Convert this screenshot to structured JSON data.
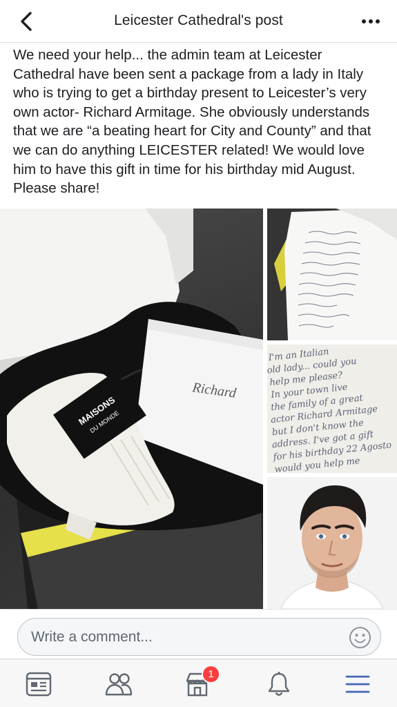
{
  "header": {
    "title": "Leicester Cathedral's post",
    "back_icon": "chevron-left-icon",
    "more_icon": "more-horizontal-icon"
  },
  "post": {
    "text": "We need your help... the admin team at Leicester Cathedral have been sent a package from a lady in Italy who is trying to get a birthday present to Leicester’s very own actor- Richard Armitage. She obviously understands that we are “a beating heart for City and County” and that we can do anything LEICESTER related! We would love him to have this gift in time for his birthday mid August. Please share!",
    "photos": [
      {
        "name": "photo-gift-box",
        "brand_line1": "MAISONS",
        "brand_line2": "DU MONDE",
        "envelope_text": "Richard"
      },
      {
        "name": "photo-handwritten-letter"
      },
      {
        "name": "photo-letter-closeup",
        "lines": [
          "I'm an Italian",
          "old lady... could you",
          "help me please?",
          "In your town live",
          "the family of a great",
          "actor Richard Armitage",
          "but I don't know the",
          "address. I've got a gift",
          "for his birthday 22 Agosto",
          "would you help me"
        ]
      },
      {
        "name": "photo-portrait-man"
      }
    ]
  },
  "comment": {
    "placeholder": "Write a comment...",
    "emoji_icon": "smiley-icon"
  },
  "tabbar": {
    "tabs": [
      {
        "name": "tab-news-feed",
        "icon": "news-feed-icon"
      },
      {
        "name": "tab-friends",
        "icon": "friends-icon"
      },
      {
        "name": "tab-marketplace",
        "icon": "marketplace-icon"
      },
      {
        "name": "tab-notifications",
        "icon": "bell-icon"
      },
      {
        "name": "tab-menu",
        "icon": "hamburger-menu-icon"
      }
    ],
    "marketplace_badge": "1",
    "accent_color": "#4267b2",
    "icon_color": "#606770",
    "badge_color": "#fa3e3e"
  }
}
